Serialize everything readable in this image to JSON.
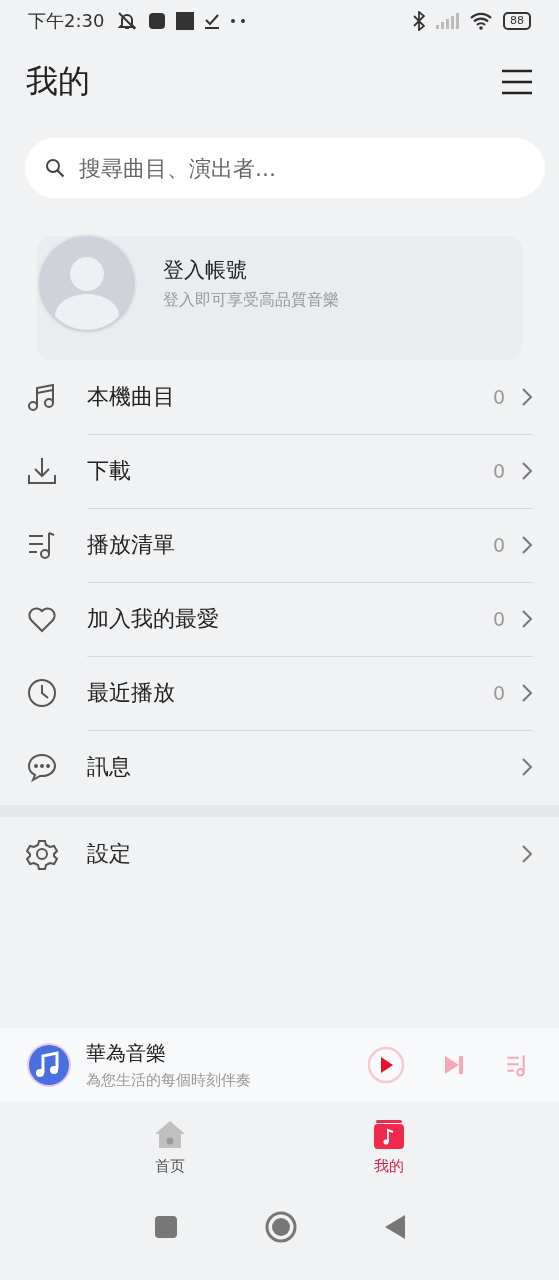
{
  "status_bar": {
    "time": "下午2:30",
    "battery": "88"
  },
  "header": {
    "title": "我的"
  },
  "search": {
    "placeholder": "搜尋曲目、演出者..."
  },
  "account": {
    "title": "登入帳號",
    "subtitle": "登入即可享受高品質音樂"
  },
  "menu": [
    {
      "label": "本機曲目",
      "count": "0"
    },
    {
      "label": "下載",
      "count": "0"
    },
    {
      "label": "播放清單",
      "count": "0"
    },
    {
      "label": "加入我的最愛",
      "count": "0"
    },
    {
      "label": "最近播放",
      "count": "0"
    },
    {
      "label": "訊息"
    }
  ],
  "settings": {
    "label": "設定"
  },
  "mini_player": {
    "title": "華為音樂",
    "subtitle": "為您生活的每個時刻伴奏"
  },
  "tabs": [
    {
      "label": "首页",
      "selected": false
    },
    {
      "label": "我的",
      "selected": true
    }
  ]
}
